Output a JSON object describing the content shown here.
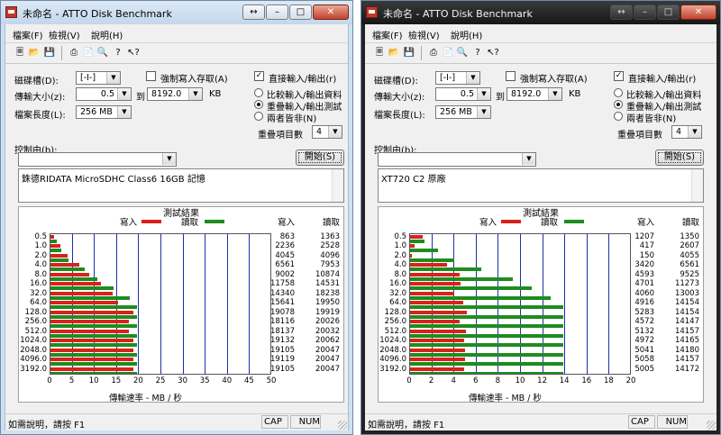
{
  "colors": {
    "read": "#1e8c1e",
    "write": "#d8221c",
    "grid": "#1f2fa8"
  },
  "windows": [
    {
      "title": "未命名 - ATTO Disk Benchmark",
      "menu": [
        "檔案(F)",
        "檢視(V)",
        "說明(H)"
      ],
      "toolbar_icons": [
        "new-icon",
        "open-icon",
        "save-icon",
        "print-icon",
        "print-preview-icon",
        "zoom-icon",
        "help-icon",
        "context-help-icon"
      ],
      "drive_label": "磁碟槽(D):",
      "drive_value": "[-I-]",
      "transfer_label": "傳輸大小(z):",
      "transfer_from": "0.5",
      "transfer_to_label": "到",
      "transfer_to": "8192.0",
      "transfer_unit": "KB",
      "length_label": "檔案長度(L):",
      "length_value": "256 MB",
      "force_write_label": "強制寫入存取(A)",
      "force_write_checked": false,
      "direct_io_label": "直接輸入/輸出(r)",
      "direct_io_checked": true,
      "radio_options": [
        "比較輸入/輸出資料",
        "重疊輸入/輸出測試",
        "兩者皆非(N)"
      ],
      "radio_selected": 1,
      "queue_label": "重疊項目數",
      "queue_value": "4",
      "controlled_by_label": "控制由(b):",
      "start_label": "開始(S)",
      "description": "銖德RIDATA MicroSDHC Class6 16GB 記憶",
      "results_title": "測試結果",
      "write_label": "寫入",
      "read_label": "讀取",
      "x_axis_label": "傳輸速率 - MB / 秒",
      "status_text": "如需說明，請按 F1",
      "status_cap": "CAP",
      "status_num": "NUM",
      "chart_data": {
        "type": "bar",
        "title": "測試結果",
        "xlabel": "傳輸速率 - MB / 秒",
        "xlim": [
          0,
          50
        ],
        "xticks": [
          "0",
          "5",
          "10",
          "15",
          "20",
          "25",
          "30",
          "35",
          "40",
          "45",
          "50"
        ],
        "categories": [
          "0.5",
          "1.0",
          "2.0",
          "4.0",
          "8.0",
          "16.0",
          "32.0",
          "64.0",
          "128.0",
          "256.0",
          "512.0",
          "1024.0",
          "2048.0",
          "4096.0",
          "3192.0"
        ],
        "series": [
          {
            "name": "寫入",
            "values": [
              863,
              2236,
              4045,
              6561,
              9002,
              11758,
              14340,
              15641,
              19078,
              18116,
              18137,
              19132,
              19105,
              19119,
              19105
            ]
          },
          {
            "name": "讀取",
            "values": [
              1363,
              2528,
              4096,
              7953,
              10874,
              14531,
              18238,
              19950,
              19919,
              20026,
              20032,
              20062,
              20047,
              20047,
              20047
            ]
          }
        ]
      }
    },
    {
      "title": "未命名 - ATTO Disk Benchmark",
      "menu": [
        "檔案(F)",
        "檢視(V)",
        "說明(H)"
      ],
      "toolbar_icons": [
        "new-icon",
        "open-icon",
        "save-icon",
        "print-icon",
        "print-preview-icon",
        "zoom-icon",
        "help-icon",
        "context-help-icon"
      ],
      "drive_label": "磁碟槽(D):",
      "drive_value": "[-I-]",
      "transfer_label": "傳輸大小(z):",
      "transfer_from": "0.5",
      "transfer_to_label": "到",
      "transfer_to": "8192.0",
      "transfer_unit": "KB",
      "length_label": "檔案長度(L):",
      "length_value": "256 MB",
      "force_write_label": "強制寫入存取(A)",
      "force_write_checked": false,
      "direct_io_label": "直接輸入/輸出(r)",
      "direct_io_checked": true,
      "radio_options": [
        "比較輸入/輸出資料",
        "重疊輸入/輸出測試",
        "兩者皆非(N)"
      ],
      "radio_selected": 1,
      "queue_label": "重疊項目數",
      "queue_value": "4",
      "controlled_by_label": "控制由(b):",
      "start_label": "開始(S)",
      "description": "XT720 C2 原廠",
      "results_title": "測試結果",
      "write_label": "寫入",
      "read_label": "讀取",
      "x_axis_label": "傳輸速率 - MB / 秒",
      "status_text": "如需說明，請按 F1",
      "status_cap": "CAP",
      "status_num": "NUM",
      "chart_data": {
        "type": "bar",
        "title": "測試結果",
        "xlabel": "傳輸速率 - MB / 秒",
        "xlim": [
          0,
          20
        ],
        "xticks": [
          "0",
          "2",
          "4",
          "6",
          "8",
          "10",
          "12",
          "14",
          "16",
          "18",
          "20"
        ],
        "categories": [
          "0.5",
          "1.0",
          "2.0",
          "4.0",
          "8.0",
          "16.0",
          "32.0",
          "64.0",
          "128.0",
          "256.0",
          "512.0",
          "1024.0",
          "2048.0",
          "4096.0",
          "3192.0"
        ],
        "series": [
          {
            "name": "寫入",
            "values": [
              1207,
              417,
              150,
              3420,
              4593,
              4701,
              4060,
              4916,
              5283,
              4572,
              5132,
              4972,
              5041,
              5058,
              5005
            ]
          },
          {
            "name": "讀取",
            "values": [
              1350,
              2607,
              4055,
              6561,
              9525,
              11273,
              13003,
              14154,
              14154,
              14147,
              14157,
              14165,
              14180,
              14157,
              14172
            ]
          }
        ]
      }
    }
  ]
}
